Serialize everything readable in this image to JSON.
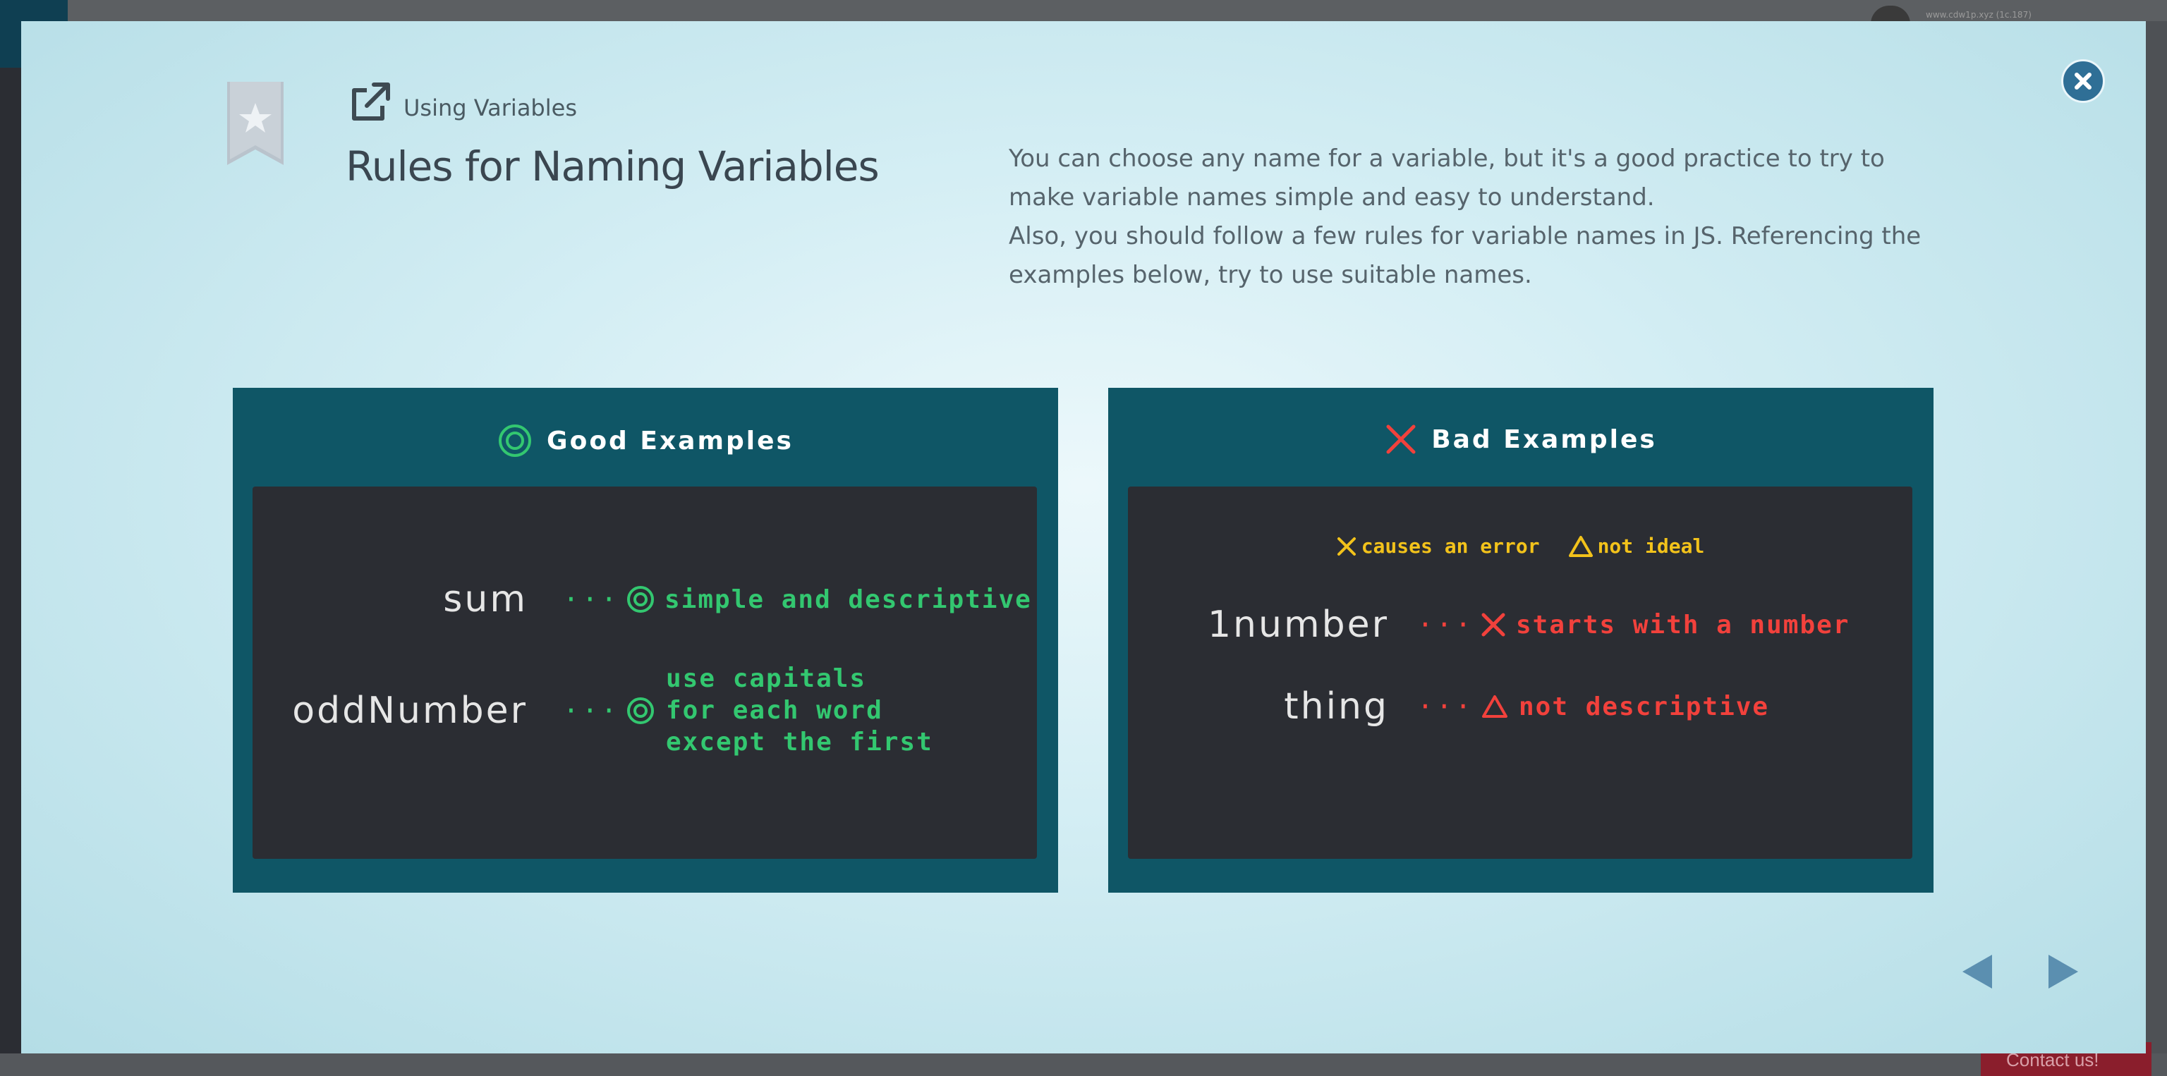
{
  "breadcrumb": {
    "label": "Using Variables"
  },
  "page": {
    "title": "Rules for Naming Variables",
    "description": [
      "You can choose any name for a variable, but it's a good practice to try to make variable names simple and easy to understand.",
      "Also, you should follow a few rules for variable names in JS. Referencing the examples below, try to use suitable names."
    ]
  },
  "good_panel": {
    "title": "Good Examples",
    "examples": [
      {
        "name": "sum",
        "dots": "···",
        "note": "simple and descriptive"
      },
      {
        "name": "oddNumber",
        "dots": "···",
        "note_lines": [
          "use capitals",
          "for each word",
          "except the first"
        ]
      }
    ]
  },
  "bad_panel": {
    "title": "Bad Examples",
    "legend": {
      "error": "causes an error",
      "not_ideal": "not ideal"
    },
    "examples": [
      {
        "name": "1number",
        "dots": "···",
        "note": "starts with a number"
      },
      {
        "name": "thing",
        "dots": "···",
        "note": "not descriptive"
      }
    ]
  },
  "background": {
    "url_text": "www.cdw1p.xyz (1c.187)",
    "contact": "Contact us!"
  },
  "colors": {
    "panel_bg": "#0f5666",
    "inner_bg": "#2b2d33",
    "good": "#33c770",
    "bad": "#f2413c",
    "legend": "#f2c21b",
    "close_button": "#2f6f96",
    "nav_arrow": "#5b8fb0"
  },
  "icons": {
    "close": "close-icon",
    "bookmark": "bookmark-star-icon",
    "external": "external-link-icon",
    "good": "double-circle-icon",
    "bad": "cross-icon",
    "triangle": "triangle-icon",
    "prev": "arrow-left-icon",
    "next": "arrow-right-icon"
  }
}
